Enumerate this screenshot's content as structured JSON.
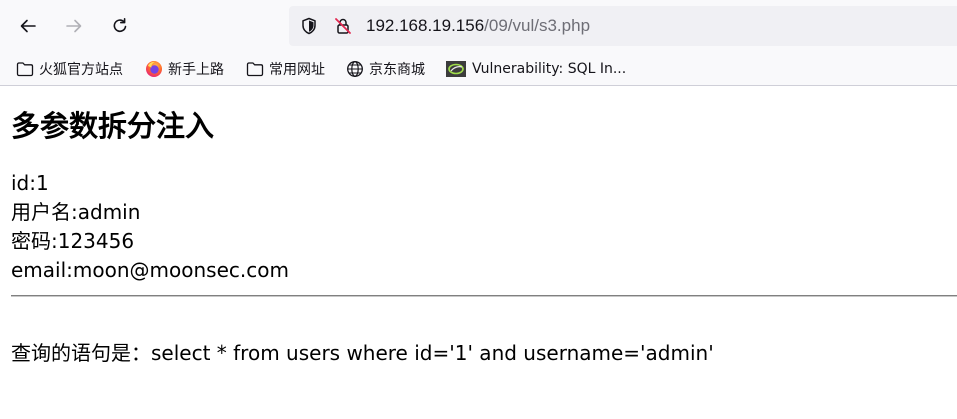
{
  "browser": {
    "url_host": "192.168.19.156",
    "url_path": "/09/vul/s3.php",
    "icons": {
      "back": "back-arrow-icon",
      "forward": "forward-arrow-icon",
      "reload": "reload-icon",
      "tracking": "shield-icon",
      "insecure": "insecure-lock-icon"
    }
  },
  "bookmarks": [
    {
      "label": "火狐官方站点",
      "icon": "folder-icon"
    },
    {
      "label": "新手上路",
      "icon": "firefox-icon"
    },
    {
      "label": "常用网址",
      "icon": "folder-icon"
    },
    {
      "label": "京东商城",
      "icon": "globe-icon"
    },
    {
      "label": "Vulnerability: SQL In...",
      "icon": "dvwa-icon"
    }
  ],
  "page": {
    "title": "多参数拆分注入",
    "id_line": "id:1",
    "username_line": "用户名:admin",
    "password_line": "密码:123456",
    "email_line": "email:moon@moonsec.com",
    "query_line": "查询的语句是：select * from users where id='1' and username='admin'"
  }
}
